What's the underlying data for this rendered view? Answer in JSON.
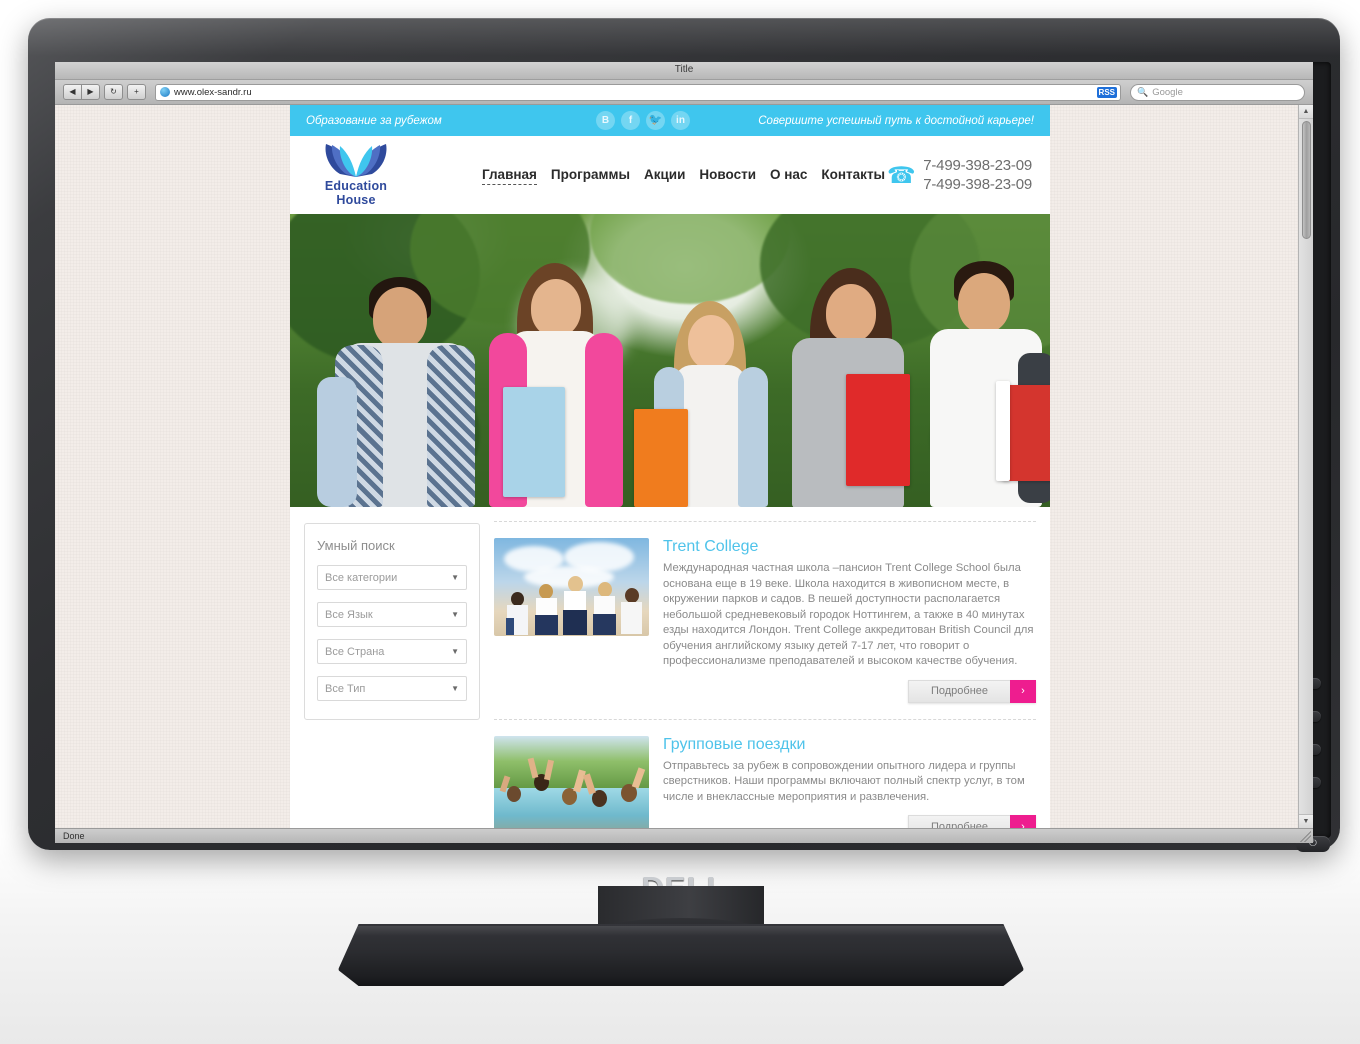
{
  "browser": {
    "window_title": "Title",
    "back_label": "◀",
    "forward_label": "▶",
    "reload_label": "↻",
    "add_label": "+",
    "url": "www.olex-sandr.ru",
    "rss_label": "RSS",
    "search_placeholder": "Google",
    "search_glyph": "🔍",
    "status_text": "Done",
    "scroll_up": "▲",
    "scroll_down": "▼"
  },
  "monitor": {
    "brand": "DELL",
    "power_glyph": "⏻"
  },
  "site": {
    "topbar": {
      "tagline_left": "Образование за рубежом",
      "tagline_right": "Совершите успешный путь к достойной карьере!",
      "social": [
        {
          "name": "vk-icon",
          "glyph": "В"
        },
        {
          "name": "facebook-icon",
          "glyph": "f"
        },
        {
          "name": "twitter-icon",
          "glyph": "🐦"
        },
        {
          "name": "linkedin-icon",
          "glyph": "in"
        }
      ]
    },
    "logo": {
      "line1": "Education",
      "line2": "House"
    },
    "nav": [
      {
        "label": "Главная",
        "active": true
      },
      {
        "label": "Программы",
        "active": false
      },
      {
        "label": "Акции",
        "active": false
      },
      {
        "label": "Новости",
        "active": false
      },
      {
        "label": "О нас",
        "active": false
      },
      {
        "label": "Контакты",
        "active": false
      }
    ],
    "phones": {
      "icon": "☎",
      "primary": "7-499-398-23-09",
      "secondary": "7-499-398-23-09"
    },
    "sidebar": {
      "title": "Умный поиск",
      "caret": "▼",
      "selects": [
        {
          "name": "category-select",
          "value": "Все категории"
        },
        {
          "name": "language-select",
          "value": "Все Язык"
        },
        {
          "name": "country-select",
          "value": "Все Страна"
        },
        {
          "name": "type-select",
          "value": "Все Тип"
        }
      ]
    },
    "articles": [
      {
        "title": "Trent College",
        "text": "Международная частная школа –пансион Trent College School была основана еще в 19 веке. Школа находится в живописном месте, в окружении парков и садов. В пешей доступности располагается небольшой средневековый городок Ноттингем, а также в 40 минутах езды находится Лондон. Trent College аккредитован British Council для обучения английскому языку детей 7-17 лет, что говорит о профессионализме преподавателей и высоком качестве обучения.",
        "more_label": "Подробнее",
        "more_arrow": "›"
      },
      {
        "title": "Групповые поездки",
        "text": "Отправьтесь за рубеж в сопровождении опытного лидера и группы сверстников. Наши программы включают полный спектр услуг, в том числе и внеклассные мероприятия и развлечения.",
        "more_label": "Подробнее",
        "more_arrow": "›"
      }
    ],
    "colors": {
      "accent_cyan": "#3fc6ee",
      "accent_magenta": "#ee1d8f",
      "logo_blue": "#2f4a9c"
    }
  }
}
